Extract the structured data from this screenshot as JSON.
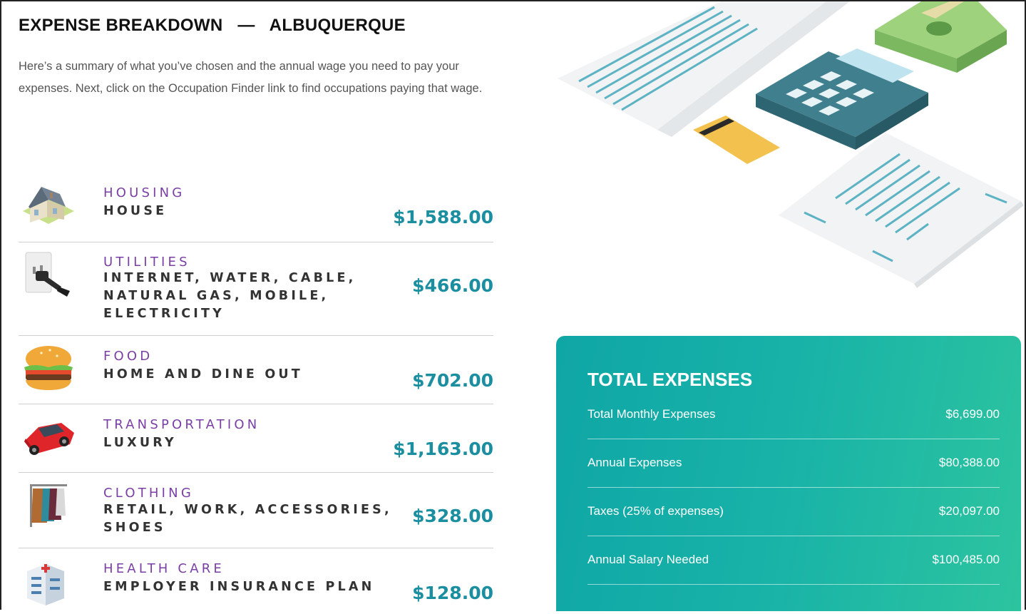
{
  "header": {
    "title": "EXPENSE BREAKDOWN   —   ALBUQUERQUE",
    "intro": "Here’s a summary of what you’ve chosen and the annual wage you need to pay your expenses. Next, click on the Occupation Finder link to find occupations paying that wage."
  },
  "expenses": [
    {
      "icon": "house-icon",
      "category": "HOUSING",
      "detail": "HOUSE",
      "amount": "$1,588.00"
    },
    {
      "icon": "plug-icon",
      "category": "UTILITIES",
      "detail": "INTERNET, WATER, CABLE, NATURAL GAS, MOBILE, ELECTRICITY",
      "amount": "$466.00"
    },
    {
      "icon": "burger-icon",
      "category": "FOOD",
      "detail": "HOME AND DINE OUT",
      "amount": "$702.00"
    },
    {
      "icon": "car-icon",
      "category": "TRANSPORTATION",
      "detail": "LUXURY",
      "amount": "$1,163.00"
    },
    {
      "icon": "clothing-rack-icon",
      "category": "CLOTHING",
      "detail": "RETAIL, WORK, ACCESSORIES, SHOES",
      "amount": "$328.00"
    },
    {
      "icon": "hospital-icon",
      "category": "HEALTH CARE",
      "detail": "EMPLOYER INSURANCE PLAN",
      "amount": "$128.00"
    }
  ],
  "totals": {
    "title": "TOTAL EXPENSES",
    "rows": [
      {
        "label": "Total Monthly Expenses",
        "value": "$6,699.00"
      },
      {
        "label": "Annual Expenses",
        "value": "$80,388.00"
      },
      {
        "label": "Taxes (25% of expenses)",
        "value": "$20,097.00"
      },
      {
        "label": "Annual Salary Needed",
        "value": "$100,485.00"
      }
    ]
  },
  "colors": {
    "category": "#7a3fa4",
    "amount": "#1b8ea0",
    "card_start": "#0fa6a6",
    "card_end": "#2cc49f"
  }
}
